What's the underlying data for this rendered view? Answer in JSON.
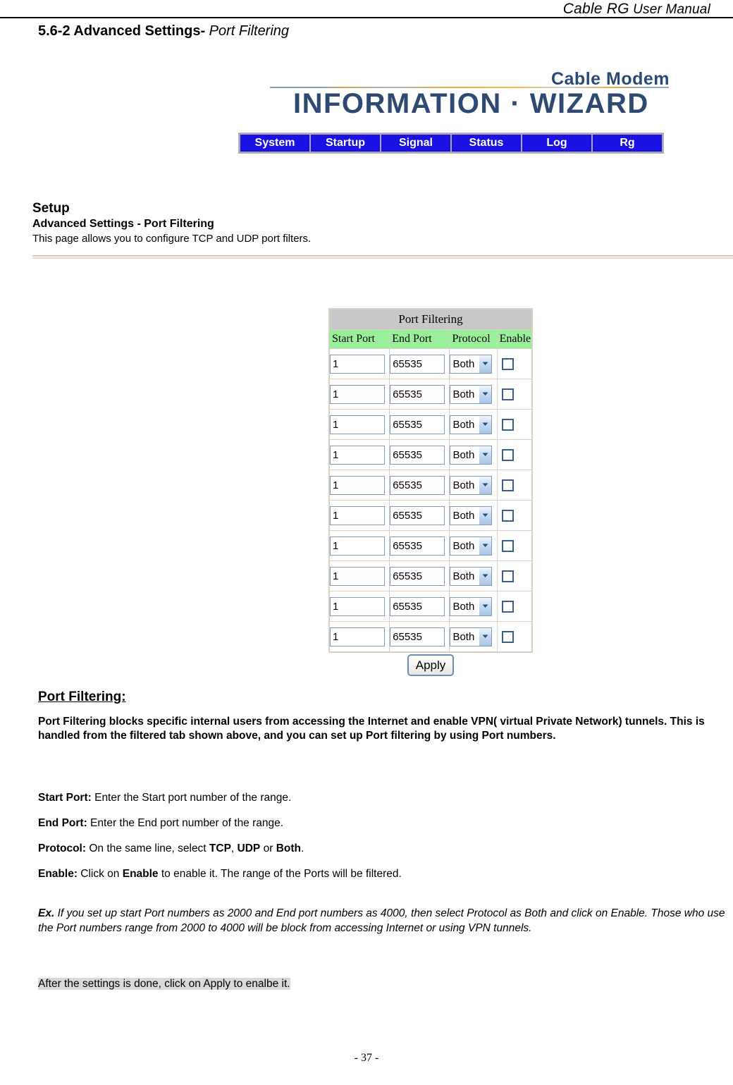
{
  "page_header": {
    "brand": "Cable RG",
    "manual": " User Manual"
  },
  "section": {
    "number": "5.6-2 Advanced Settings-",
    "name": " Port Filtering"
  },
  "banner": {
    "top_text": "Cable Modem",
    "main_text": "INFORMATION  ·  WIZARD"
  },
  "nav": {
    "tabs": [
      {
        "label": "System"
      },
      {
        "label": "Startup"
      },
      {
        "label": "Signal"
      },
      {
        "label": "Status"
      },
      {
        "label": "Log"
      },
      {
        "label": "Rg"
      }
    ]
  },
  "setup": {
    "title": "Setup",
    "subtitle": "Advanced Settings - Port Filtering",
    "description": "This page allows you to configure TCP and UDP port filters."
  },
  "port_filtering_table": {
    "caption": "Port Filtering",
    "columns": [
      "Start Port",
      "End Port",
      "Protocol",
      "Enable"
    ],
    "rows": [
      {
        "start_port": "1",
        "end_port": "65535",
        "protocol": "Both",
        "enable": false
      },
      {
        "start_port": "1",
        "end_port": "65535",
        "protocol": "Both",
        "enable": false
      },
      {
        "start_port": "1",
        "end_port": "65535",
        "protocol": "Both",
        "enable": false
      },
      {
        "start_port": "1",
        "end_port": "65535",
        "protocol": "Both",
        "enable": false
      },
      {
        "start_port": "1",
        "end_port": "65535",
        "protocol": "Both",
        "enable": false
      },
      {
        "start_port": "1",
        "end_port": "65535",
        "protocol": "Both",
        "enable": false
      },
      {
        "start_port": "1",
        "end_port": "65535",
        "protocol": "Both",
        "enable": false
      },
      {
        "start_port": "1",
        "end_port": "65535",
        "protocol": "Both",
        "enable": false
      },
      {
        "start_port": "1",
        "end_port": "65535",
        "protocol": "Both",
        "enable": false
      },
      {
        "start_port": "1",
        "end_port": "65535",
        "protocol": "Both",
        "enable": false
      }
    ],
    "protocol_options": [
      "TCP",
      "UDP",
      "Both"
    ],
    "apply_label": "Apply",
    "colors": {
      "caption_bg": "#c8c8c8",
      "header_bg": "#9af09a",
      "border": "#d6d3c4"
    }
  },
  "body_copy": {
    "heading": "Port Filtering:",
    "paragraph": "Port Filtering blocks specific internal users from accessing the Internet and enable VPN( virtual Private Network) tunnels. This is handled from the filtered tab shown above, and you can set up Port filtering by using Port numbers.",
    "fields": [
      {
        "label": "Start Port:",
        "text_1": "  Enter the Start port number of the range.",
        "bold_1": "",
        "text_2": "",
        "bold_2": "",
        "text_3": ""
      },
      {
        "label": "End Port:",
        "text_1": "  Enter the End port number of the range.",
        "bold_1": "",
        "text_2": "",
        "bold_2": "",
        "text_3": ""
      },
      {
        "label": "Protocol:",
        "text_1": "  On the same line, select ",
        "bold_1": "TCP",
        "text_2": ", ",
        "bold_2": "UDP",
        "text_3": " or ",
        "bold_3": "Both",
        "text_4": "."
      },
      {
        "label": "Enable:",
        "text_1": " Click on ",
        "bold_1": "Enable",
        "text_2": " to enable it. The range of the Ports will be filtered.",
        "bold_2": "",
        "text_3": ""
      }
    ],
    "example_label": "Ex.",
    "example_text": " If you set up start Port numbers as 2000 and End port numbers as 4000, then select Protocol as Both and click on Enable. Those who use the Port numbers range from 2000 to 4000 will be block from accessing Internet or using VPN tunnels.",
    "final_note": "After the settings is done, click on Apply to enalbe it."
  },
  "footer": {
    "page_number": "- 37 -"
  }
}
